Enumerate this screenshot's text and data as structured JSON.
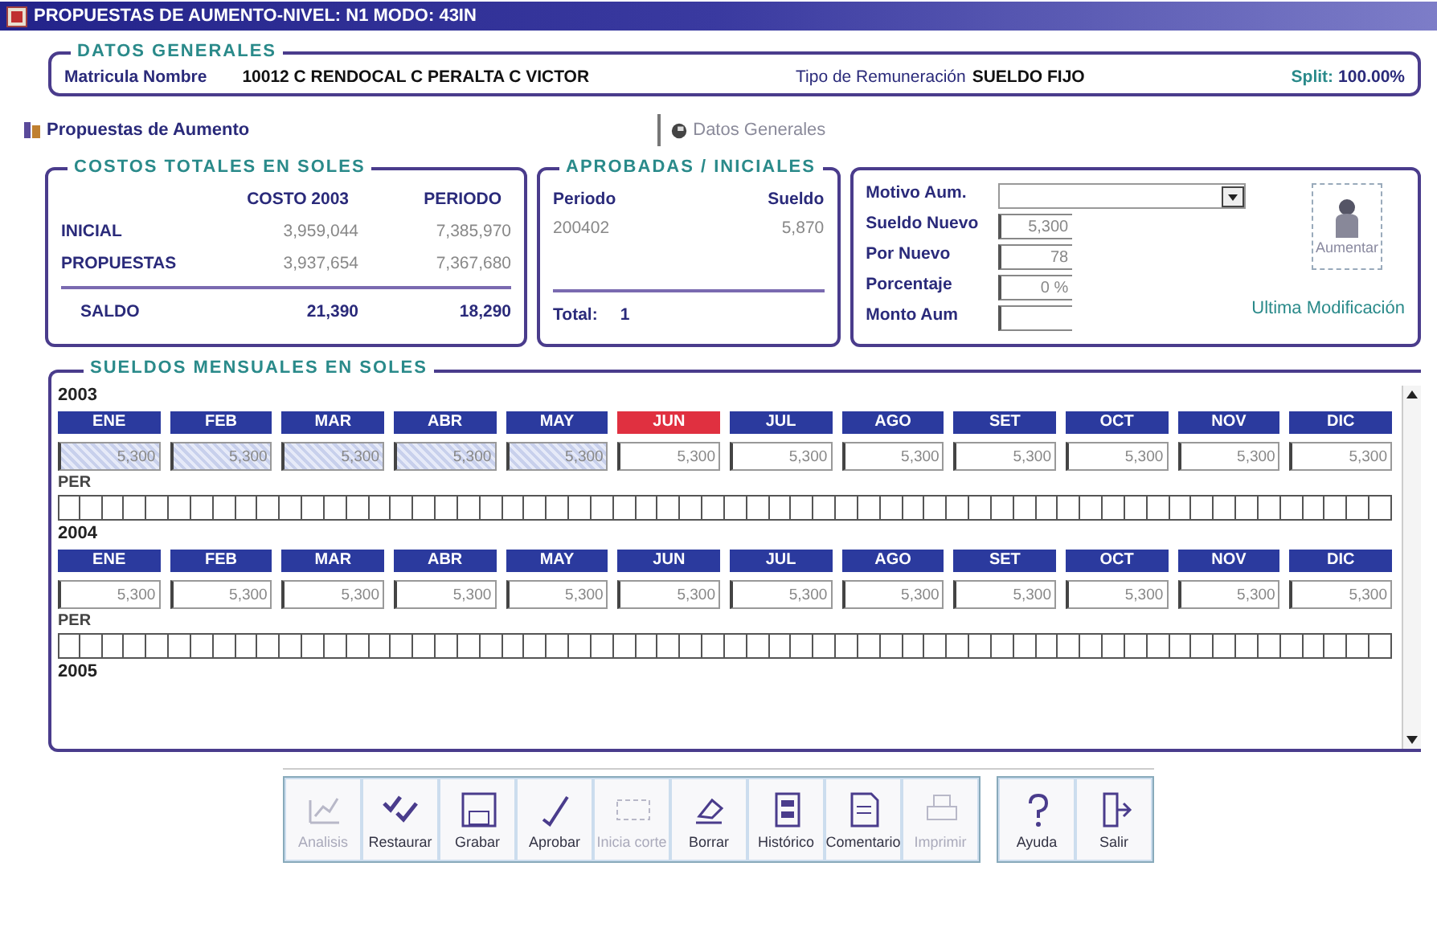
{
  "window": {
    "title": "PROPUESTAS DE AUMENTO-NIVEL: N1 MODO: 43IN"
  },
  "general": {
    "title": "DATOS GENERALES",
    "fields": [
      {
        "label": "Matricula Nombre",
        "value": "10012 C RENDOCAL C PERALTA C VICTOR"
      },
      {
        "label": "Tipo de Remuneración",
        "value": "SUELDO FIJO"
      },
      {
        "label": "Split:",
        "value": "100.00%"
      }
    ]
  },
  "tabs": [
    {
      "label": "Propuestas de Aumento",
      "selected": true
    },
    {
      "label": "Datos Generales",
      "selected": false
    }
  ],
  "costs": {
    "title": "COSTOS TOTALES EN SOLES",
    "columns": [
      "COSTO 2003",
      "PERIODO"
    ],
    "rows": [
      {
        "label": "INICIAL",
        "values": [
          "3,959,044",
          "7,385,970"
        ],
        "kind": "plain"
      },
      {
        "label": "PROPUESTAS",
        "values": [
          "3,937,654",
          "7,367,680"
        ],
        "kind": "plain"
      },
      {
        "label": "SALDO",
        "values": [
          "21,390",
          "18,290"
        ],
        "kind": "total"
      }
    ]
  },
  "approved": {
    "title": "APROBADAS / INICIALES",
    "columns": [
      "Periodo",
      "Sueldo"
    ],
    "rows": [
      [
        "200402",
        "5,870"
      ]
    ],
    "total_label": "Total:",
    "total": "1"
  },
  "raise": {
    "fields": [
      {
        "label": "Motivo Aum.",
        "kind": "select"
      },
      {
        "label": "Sueldo Nuevo",
        "kind": "text",
        "value": "5,300"
      },
      {
        "label": "Por Nuevo",
        "kind": "text",
        "value": "78"
      },
      {
        "label": "Porcentaje",
        "kind": "text",
        "value": "0 %"
      },
      {
        "label": "Monto Aum",
        "kind": "text"
      }
    ],
    "button": "Aumentar",
    "note": "Ultima Modificación"
  },
  "monthly": {
    "title": "SUELDOS MENSUALES EN SOLES",
    "years": [
      {
        "year": "2003",
        "per_label": "PER",
        "months": [
          {
            "label": "ENE",
            "value": "5,300",
            "locked": true,
            "selected": false
          },
          {
            "label": "FEB",
            "value": "5,300",
            "locked": true,
            "selected": false
          },
          {
            "label": "MAR",
            "value": "5,300",
            "locked": true,
            "selected": false
          },
          {
            "label": "ABR",
            "value": "5,300",
            "locked": true,
            "selected": false
          },
          {
            "label": "MAY",
            "value": "5,300",
            "locked": true,
            "selected": false
          },
          {
            "label": "JUN",
            "value": "5,300",
            "locked": false,
            "selected": true
          },
          {
            "label": "JUL",
            "value": "5,300",
            "locked": false,
            "selected": false
          },
          {
            "label": "AGO",
            "value": "5,300",
            "locked": false,
            "selected": false
          },
          {
            "label": "SET",
            "value": "5,300",
            "locked": false,
            "selected": false
          },
          {
            "label": "OCT",
            "value": "5,300",
            "locked": false,
            "selected": false
          },
          {
            "label": "NOV",
            "value": "5,300",
            "locked": false,
            "selected": false
          },
          {
            "label": "DIC",
            "value": "5,300",
            "locked": false,
            "selected": false
          }
        ]
      },
      {
        "year": "2004",
        "per_label": "PER",
        "months": [
          {
            "label": "ENE",
            "value": "5,300",
            "locked": false,
            "selected": false
          },
          {
            "label": "FEB",
            "value": "5,300",
            "locked": false,
            "selected": false
          },
          {
            "label": "MAR",
            "value": "5,300",
            "locked": false,
            "selected": false
          },
          {
            "label": "ABR",
            "value": "5,300",
            "locked": false,
            "selected": false
          },
          {
            "label": "MAY",
            "value": "5,300",
            "locked": false,
            "selected": false
          },
          {
            "label": "JUN",
            "value": "5,300",
            "locked": false,
            "selected": false
          },
          {
            "label": "JUL",
            "value": "5,300",
            "locked": false,
            "selected": false
          },
          {
            "label": "AGO",
            "value": "5,300",
            "locked": false,
            "selected": false
          },
          {
            "label": "SET",
            "value": "5,300",
            "locked": false,
            "selected": false
          },
          {
            "label": "OCT",
            "value": "5,300",
            "locked": false,
            "selected": false
          },
          {
            "label": "NOV",
            "value": "5,300",
            "locked": false,
            "selected": false
          },
          {
            "label": "DIC",
            "value": "5,300",
            "locked": false,
            "selected": false
          }
        ]
      },
      {
        "year": "2005"
      }
    ]
  },
  "toolbar": {
    "groups": [
      [
        {
          "label": "Analisis",
          "kind": "chart",
          "disabled": true
        },
        {
          "label": "Restaurar",
          "kind": "checks",
          "disabled": false
        },
        {
          "label": "Grabar",
          "kind": "disk",
          "disabled": false
        },
        {
          "label": "Aprobar",
          "kind": "check",
          "disabled": false
        },
        {
          "label": "Inicia corte",
          "kind": "scissors",
          "disabled": true
        },
        {
          "label": "Borrar",
          "kind": "erase",
          "disabled": false
        },
        {
          "label": "Histórico",
          "kind": "book",
          "disabled": false
        },
        {
          "label": "Comentario",
          "kind": "note",
          "disabled": false
        },
        {
          "label": "Imprimir",
          "kind": "printer",
          "disabled": true
        }
      ],
      [
        {
          "label": "Ayuda",
          "kind": "help",
          "disabled": false
        },
        {
          "label": "Salir",
          "kind": "exit",
          "disabled": false
        }
      ]
    ]
  }
}
